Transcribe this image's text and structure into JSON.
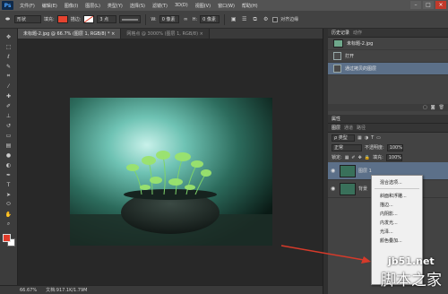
{
  "menubar": {
    "logo": "Ps",
    "items": [
      "文件(F)",
      "编辑(E)",
      "图像(I)",
      "图层(L)",
      "类型(Y)",
      "选择(S)",
      "滤镜(T)",
      "3D(D)",
      "视图(V)",
      "窗口(W)",
      "帮助(H)"
    ],
    "window_controls": [
      "–",
      "□",
      "×"
    ]
  },
  "options_bar": {
    "mode_label": "形状",
    "fill_label": "填充:",
    "fill_color": "#e5432f",
    "stroke_label": "描边:",
    "stroke_size": "3 点",
    "width_label": "W:",
    "width_value": "0 像素",
    "height_label": "H:",
    "height_value": "0 像素",
    "align_edges_label": "对齐边缘"
  },
  "tabs": [
    {
      "label": "未标题-2.jpg @ 66.7% (图层 1, RGB/8) *  ×",
      "active": true
    },
    {
      "label": "网格点 @ 3000% (图层 1, RGB/8)  ×",
      "active": false
    }
  ],
  "toolbar": {
    "tools": [
      "move-tool",
      "marquee-tool",
      "lasso-tool",
      "quick-select-tool",
      "crop-tool",
      "eyedropper-tool",
      "healing-tool",
      "brush-tool",
      "stamp-tool",
      "history-brush-tool",
      "eraser-tool",
      "gradient-tool",
      "blur-tool",
      "dodge-tool",
      "pen-tool",
      "type-tool",
      "path-select-tool",
      "shape-tool",
      "hand-tool",
      "zoom-tool"
    ],
    "foreground_color": "#e23b2a",
    "background_color": "#ffffff"
  },
  "status": {
    "zoom": "66.67%",
    "doc_size": "文档:917.1K/1.79M"
  },
  "history": {
    "tabs": [
      "历史记录",
      "动作"
    ],
    "rows": [
      {
        "label": "未标题-2.jpg",
        "type": "snapshot",
        "selected": false
      },
      {
        "label": "打开",
        "type": "step",
        "selected": false
      },
      {
        "label": "通过拷贝的图层",
        "type": "step",
        "selected": true
      }
    ]
  },
  "layers": {
    "header_label": "属性",
    "tabs": [
      "图层",
      "通道",
      "路径"
    ],
    "kind_label": "ρ 类型",
    "blend_mode": "正常",
    "opacity_label": "不透明度:",
    "opacity_value": "100%",
    "lock_label": "锁定:",
    "fill_label": "填充:",
    "fill_value": "100%",
    "items": [
      {
        "name": "图层 1",
        "selected": true
      },
      {
        "name": "背景",
        "selected": false
      }
    ]
  },
  "context_menu": {
    "items": [
      "混合选项...",
      "斜面和浮雕...",
      "描边...",
      "内阴影...",
      "内发光...",
      "光泽...",
      "颜色叠加..."
    ]
  },
  "watermark": {
    "url": "jb51.net",
    "name": "脚本之家"
  },
  "colors": {
    "accent_selection": "#5c7089",
    "arrow": "#d63a2a"
  }
}
